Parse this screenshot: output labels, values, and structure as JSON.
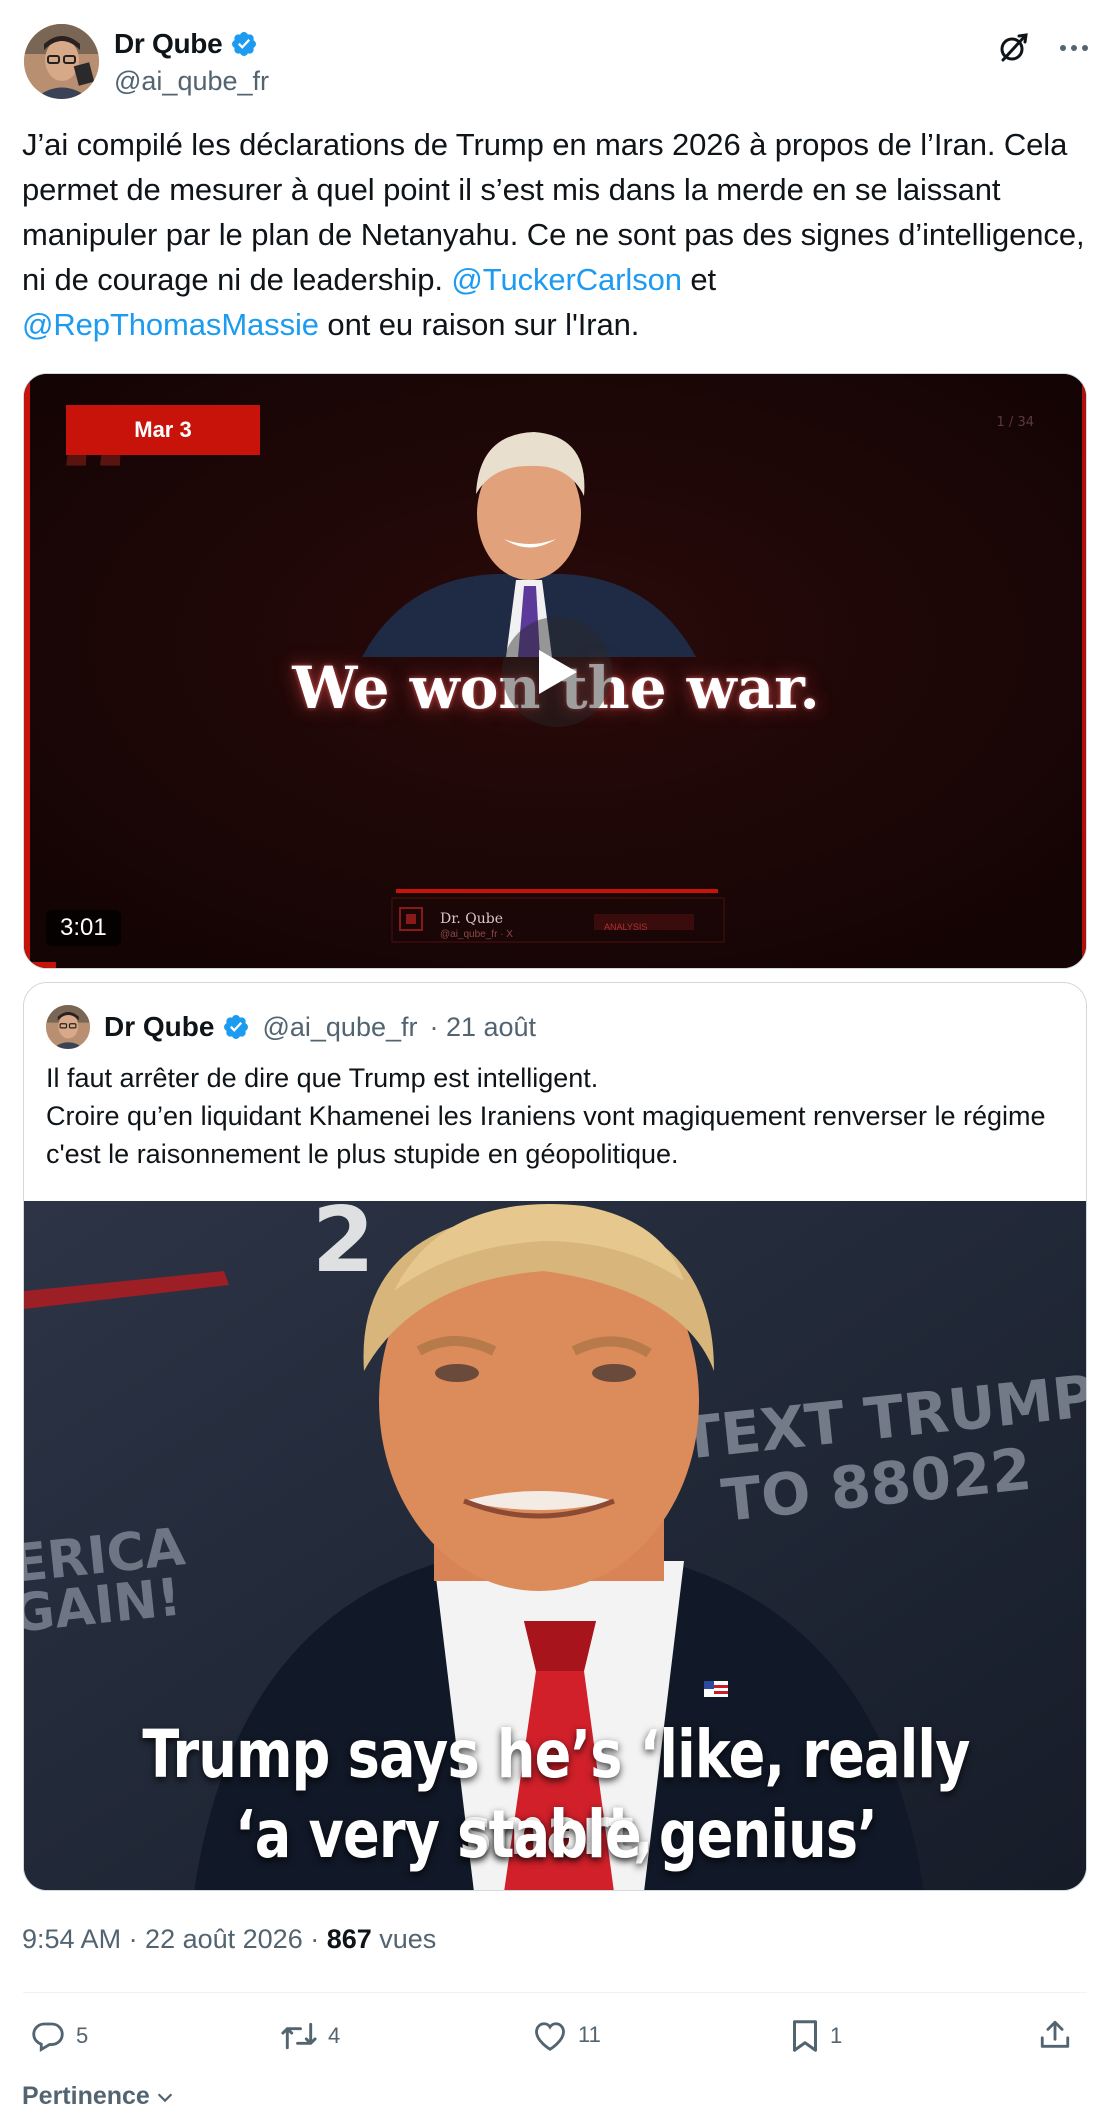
{
  "author": {
    "name": "Dr Qube",
    "handle": "@ai_qube_fr"
  },
  "tweet": {
    "text_1": "J’ai compilé les déclarations de Trump en mars 2026 à propos de l’Iran. Cela permet de mesurer à quel point il s’est mis dans la merde en se laissant manipuler par le plan de Netanyahu. Ce ne sont pas des signes d’intelligence, ni de courage ni de leadership. ",
    "mention_1": "@TuckerCarlson",
    "text_2": " et ",
    "mention_2": "@RepThomasMassie",
    "text_3": " ont eu raison sur l'Iran."
  },
  "video": {
    "date_label": "Mar 3",
    "slide_counter": "1 / 34",
    "caption": "We won the war.",
    "duration": "3:01",
    "progress": 0.03,
    "watermark_name": "Dr. Qube",
    "watermark_handle": "@ai_qube_fr  ·  X",
    "watermark_tag": "ANALYSIS"
  },
  "quoted": {
    "name": "Dr Qube",
    "handle": "@ai_qube_fr",
    "date": "· 21 août",
    "text_line_1": "Il faut arrêter de dire que Trump est intelligent.",
    "text_line_2": "Croire qu’en liquidant Khamenei les Iraniens vont magiquement renverser le régime c'est le raisonnement le plus stupide en géopolitique.",
    "image_caption_1": "Trump says he’s ‘like, really smart,",
    "image_caption_2": "‘a very stable genius’",
    "image_bg_text_1": "TEXT TRUMP",
    "image_bg_text_2": "TO 88022",
    "image_bg_text_3": "ERICA",
    "image_bg_text_4": "GAIN!"
  },
  "meta": {
    "time_date": "9:54 AM · 22 août 2026 · ",
    "views_count": "867",
    "views_label": " vues"
  },
  "actions": {
    "replies": "5",
    "reposts": "4",
    "likes": "11",
    "bookmarks": "1"
  },
  "sort_label": "Pertinence",
  "colors": {
    "accent": "#1d9bf0",
    "text": "#0f1419",
    "secondary": "#536471",
    "video_red": "#c8130a"
  },
  "icons": [
    "verified-badge-icon",
    "grok-icon",
    "more-icon",
    "play-icon",
    "reply-icon",
    "repost-icon",
    "like-icon",
    "bookmark-icon",
    "share-icon",
    "chevron-down-icon"
  ]
}
